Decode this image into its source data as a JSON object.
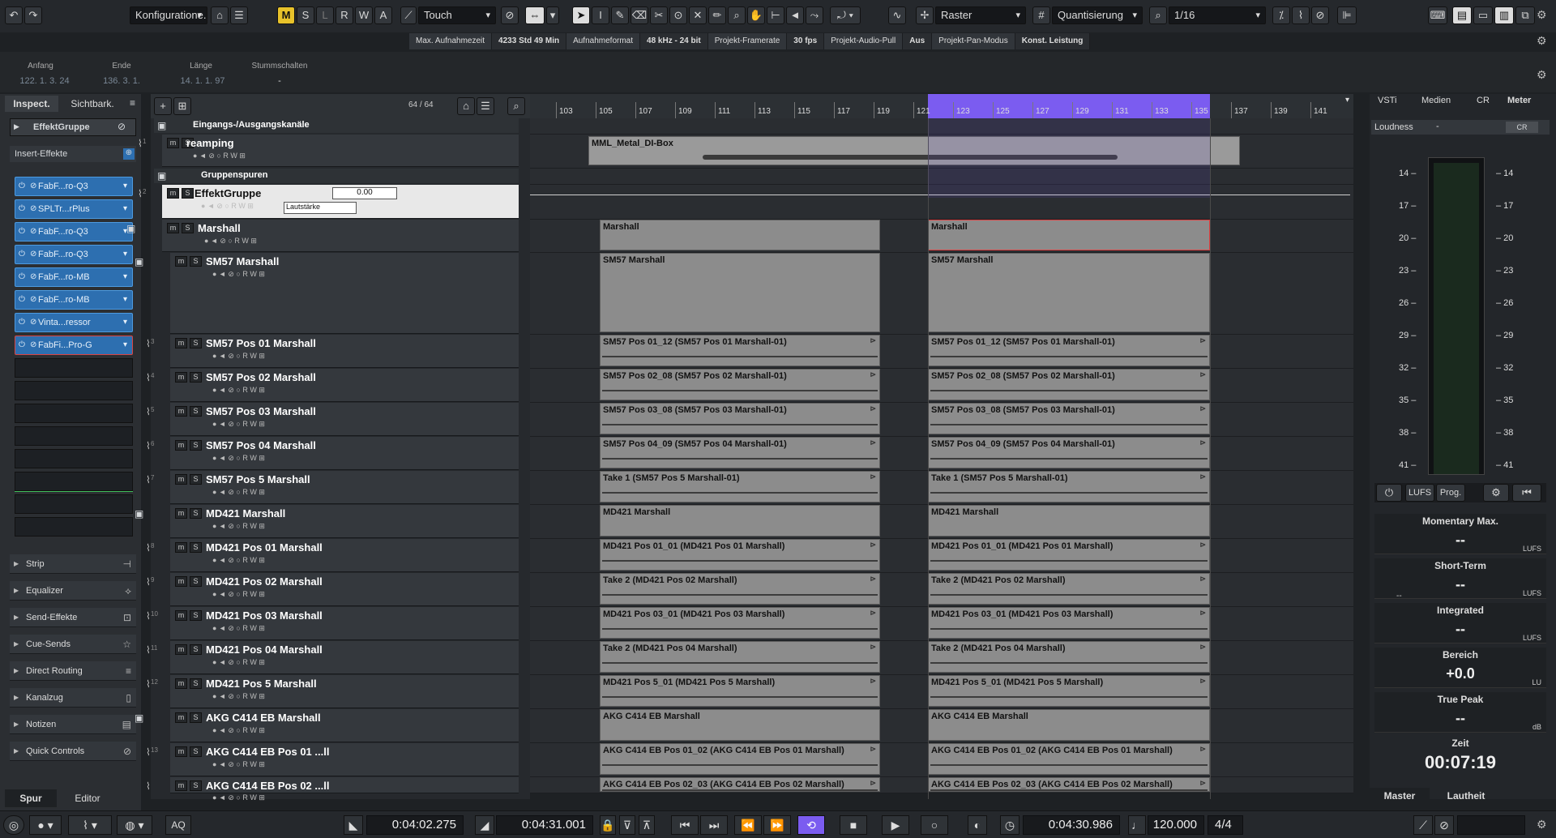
{
  "toolbar": {
    "config": "Konfiguratione.",
    "m": "M",
    "s": "S",
    "l": "L",
    "r": "R",
    "w": "W",
    "a": "A",
    "automation_mode": "Touch",
    "grid_type": "Raster",
    "quantize_label": "Quantisierung",
    "quantize_value": "1/16"
  },
  "infobar": [
    {
      "label": "Max. Aufnahmezeit",
      "value": "4233 Std 49 Min"
    },
    {
      "label": "Aufnahmeformat",
      "value": "48 kHz - 24 bit"
    },
    {
      "label": "Projekt-Framerate",
      "value": "30 fps"
    },
    {
      "label": "Projekt-Audio-Pull",
      "value": "Aus"
    },
    {
      "label": "Projekt-Pan-Modus",
      "value": "Konst. Leistung"
    }
  ],
  "selection": {
    "start_label": "Anfang",
    "start": "122. 1. 3. 24",
    "end_label": "Ende",
    "end": "136. 3. 1.",
    "length_label": "Länge",
    "length": "14. 1. 1. 97",
    "mute_label": "Stummschalten",
    "mute": "-"
  },
  "inspector": {
    "tab1": "Inspect.",
    "tab2": "Sichtbark.",
    "track_name": "EffektGruppe",
    "insert_title": "Insert-Effekte",
    "inserts": [
      "FabF...ro-Q3",
      "SPLTr...rPlus",
      "FabF...ro-Q3",
      "FabF...ro-Q3",
      "FabF...ro-MB",
      "FabF...ro-MB",
      "Vinta...ressor",
      "FabFi...Pro-G"
    ],
    "sections": [
      "Strip",
      "Equalizer",
      "Send-Effekte",
      "Cue-Sends",
      "Direct Routing",
      "Kanalzug",
      "Notizen",
      "Quick Controls"
    ],
    "bottom_tab1": "Spur",
    "bottom_tab2": "Editor"
  },
  "tracklist": {
    "count": "64 / 64",
    "folder_io": "Eingangs-/Ausgangskanäle",
    "group_folder": "Gruppenspuren",
    "effekt_volume": "0.00",
    "effekt_param": "Lautstärke",
    "tracks": [
      {
        "name": "reamping",
        "num": "1"
      },
      {
        "name": "EffektGruppe",
        "num": "2"
      },
      {
        "name": "Marshall",
        "num": ""
      },
      {
        "name": "SM57 Marshall",
        "num": ""
      },
      {
        "name": "SM57 Pos 01 Marshall",
        "num": "3"
      },
      {
        "name": "SM57 Pos 02 Marshall",
        "num": "4"
      },
      {
        "name": "SM57 Pos 03 Marshall",
        "num": "5"
      },
      {
        "name": "SM57 Pos 04 Marshall",
        "num": "6"
      },
      {
        "name": "SM57 Pos 5 Marshall",
        "num": "7"
      },
      {
        "name": "MD421 Marshall",
        "num": ""
      },
      {
        "name": "MD421 Pos 01 Marshall",
        "num": "8"
      },
      {
        "name": "MD421 Pos 02 Marshall",
        "num": "9"
      },
      {
        "name": "MD421 Pos 03 Marshall",
        "num": "10"
      },
      {
        "name": "MD421 Pos 04 Marshall",
        "num": "11"
      },
      {
        "name": "MD421 Pos 5 Marshall",
        "num": "12"
      },
      {
        "name": "AKG C414 EB Marshall",
        "num": ""
      },
      {
        "name": "AKG C414 EB Pos 01 ...ll",
        "num": "13"
      },
      {
        "name": "AKG C414 EB Pos 02 ...ll",
        "num": ""
      }
    ]
  },
  "ruler": [
    "103",
    "105",
    "107",
    "109",
    "111",
    "113",
    "115",
    "117",
    "119",
    "121",
    "123",
    "125",
    "127",
    "129",
    "131",
    "133",
    "135",
    "137",
    "139",
    "141"
  ],
  "events": {
    "reamp": "MML_Metal_DI-Box",
    "left": [
      "Marshall",
      "SM57 Marshall",
      "SM57 Pos 01_12 (SM57 Pos 01 Marshall-01)",
      "SM57 Pos 02_08 (SM57 Pos 02 Marshall-01)",
      "SM57 Pos 03_08 (SM57 Pos 03 Marshall-01)",
      "SM57 Pos 04_09 (SM57 Pos 04 Marshall-01)",
      "Take 1 (SM57 Pos 5 Marshall-01)",
      "MD421 Marshall",
      "MD421 Pos 01_01 (MD421 Pos 01 Marshall)",
      "Take 2 (MD421 Pos 02 Marshall)",
      "MD421 Pos 03_01 (MD421 Pos 03 Marshall)",
      "Take 2 (MD421 Pos 04 Marshall)",
      "MD421 Pos 5_01 (MD421 Pos 5 Marshall)",
      "AKG C414 EB Marshall",
      "AKG C414 EB Pos 01_02 (AKG C414 EB Pos 01 Marshall)",
      "AKG C414 EB Pos 02_03 (AKG C414 EB Pos 02 Marshall)"
    ],
    "right": [
      "Marshall",
      "SM57 Marshall",
      "SM57 Pos 01_12 (SM57 Pos 01 Marshall-01)",
      "SM57 Pos 02_08 (SM57 Pos 02 Marshall-01)",
      "SM57 Pos 03_08 (SM57 Pos 03 Marshall-01)",
      "SM57 Pos 04_09 (SM57 Pos 04 Marshall-01)",
      "Take 1 (SM57 Pos 5 Marshall-01)",
      "MD421 Marshall",
      "MD421 Pos 01_01 (MD421 Pos 01 Marshall)",
      "Take 2 (MD421 Pos 02 Marshall)",
      "MD421 Pos 03_01 (MD421 Pos 03 Marshall)",
      "Take 2 (MD421 Pos 04 Marshall)",
      "MD421 Pos 5_01 (MD421 Pos 5 Marshall)",
      "AKG C414 EB Marshall",
      "AKG C414 EB Pos 01_02 (AKG C414 EB Pos 01 Marshall)",
      "AKG C414 EB Pos 02_03 (AKG C414 EB Pos 02 Marshall)"
    ]
  },
  "meter": {
    "tabs": [
      "VSTi",
      "Medien",
      "CR",
      "Meter"
    ],
    "loudness": "Loudness",
    "loudness_dash": "-",
    "cr": "CR",
    "scale": [
      "14",
      "17",
      "20",
      "23",
      "26",
      "29",
      "32",
      "35",
      "38",
      "41"
    ],
    "btn_lufs": "LUFS",
    "btn_prog": "Prog.",
    "stats": [
      {
        "label": "Momentary Max.",
        "value": "--",
        "unit": "LUFS"
      },
      {
        "label": "Short-Term",
        "value": "--",
        "unit": "LUFS"
      },
      {
        "label": "Integrated",
        "value": "--",
        "unit": "LUFS"
      },
      {
        "label": "Bereich",
        "value": "+0.0",
        "unit": "LU"
      },
      {
        "label": "True Peak",
        "value": "--",
        "unit": "dB"
      }
    ],
    "short_term_extra": "--",
    "time_label": "Zeit",
    "time": "00:07:19",
    "tab_master": "Master",
    "tab_lautheit": "Lautheit"
  },
  "transport": {
    "aq": "AQ",
    "left_locator": "0:04:02.275",
    "right_locator": "0:04:31.001",
    "position": "0:04:30.986",
    "tempo": "120.000",
    "signature": "4/4"
  },
  "colors": {
    "accent": "#7b5cf0",
    "insert_blue": "#2d6fb0",
    "selected_track": "#e8e8e8"
  }
}
